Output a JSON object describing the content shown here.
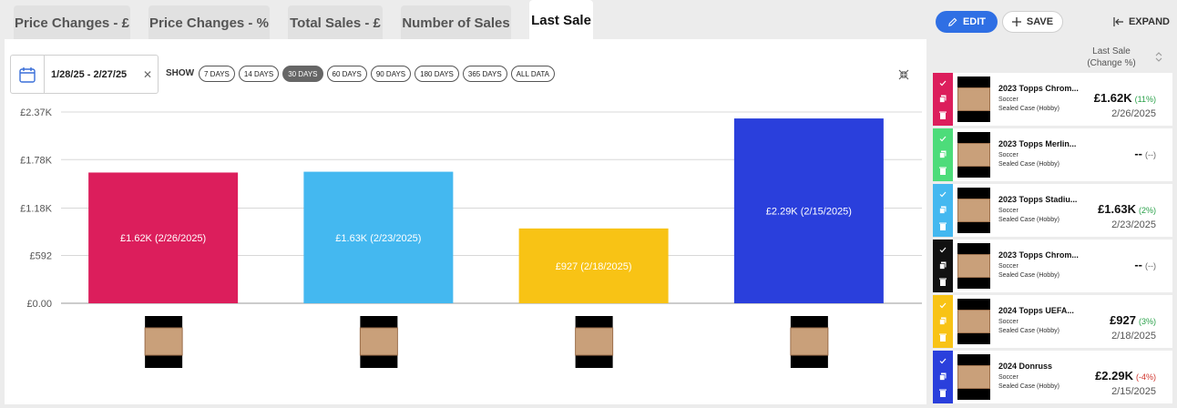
{
  "tabs": [
    {
      "label": "Price Changes - £"
    },
    {
      "label": "Price Changes - %"
    },
    {
      "label": "Total Sales - £"
    },
    {
      "label": "Number of Sales"
    },
    {
      "label": "Last Sale"
    }
  ],
  "actions": {
    "edit": "EDIT",
    "save": "SAVE",
    "expand": "EXPAND"
  },
  "filters": {
    "date_range": "1/28/25 - 2/27/25",
    "show_label": "SHOW",
    "ranges": [
      "7 DAYS",
      "14 DAYS",
      "30 DAYS",
      "60 DAYS",
      "90 DAYS",
      "180 DAYS",
      "365 DAYS",
      "ALL DATA"
    ],
    "active_range": "30 DAYS"
  },
  "chart_data": {
    "type": "bar",
    "categories": [
      "2023 Topps Chrome",
      "2023 Topps Merlin",
      "2024 Topps UEFA",
      "2024 Donruss"
    ],
    "values": [
      1620,
      1630,
      927,
      2290
    ],
    "bar_labels": [
      "£1.62K (2/26/2025)",
      "£1.63K (2/23/2025)",
      "£927 (2/18/2025)",
      "£2.29K (2/15/2025)"
    ],
    "colors": [
      "#dc1e5c",
      "#44b8f0",
      "#f8c315",
      "#2a3fdc"
    ],
    "y_ticks": [
      "£0.00",
      "£592",
      "£1.18K",
      "£1.78K",
      "£2.37K"
    ],
    "ylim": [
      0,
      2370
    ]
  },
  "sidebar": {
    "header_line1": "Last Sale",
    "header_line2": "(Change %)",
    "rows": [
      {
        "title": "2023 Topps Chrom...",
        "sport": "Soccer",
        "kind": "Sealed Case (Hobby)",
        "price": "£1.62K",
        "change": "(11%)",
        "change_color": "#2aa14a",
        "date": "2/26/2025",
        "color": "#dc1e5c"
      },
      {
        "title": "2023 Topps Merlin...",
        "sport": "Soccer",
        "kind": "Sealed Case (Hobby)",
        "price": "--",
        "change": "(--)",
        "change_color": "#666666",
        "date": "",
        "color": "#4ddc7a"
      },
      {
        "title": "2023 Topps Stadiu...",
        "sport": "Soccer",
        "kind": "Sealed Case (Hobby)",
        "price": "£1.63K",
        "change": "(2%)",
        "change_color": "#2aa14a",
        "date": "2/23/2025",
        "color": "#44b8f0"
      },
      {
        "title": "2023 Topps Chrom...",
        "sport": "Soccer",
        "kind": "Sealed Case (Hobby)",
        "price": "--",
        "change": "(--)",
        "change_color": "#666666",
        "date": "",
        "color": "#111111"
      },
      {
        "title": "2024 Topps UEFA...",
        "sport": "Soccer",
        "kind": "Sealed Case (Hobby)",
        "price": "£927",
        "change": "(3%)",
        "change_color": "#2aa14a",
        "date": "2/18/2025",
        "color": "#f8c315"
      },
      {
        "title": "2024 Donruss",
        "sport": "Soccer",
        "kind": "Sealed Case (Hobby)",
        "price": "£2.29K",
        "change": "(-4%)",
        "change_color": "#d0342c",
        "date": "2/15/2025",
        "color": "#2a3fdc"
      }
    ]
  }
}
